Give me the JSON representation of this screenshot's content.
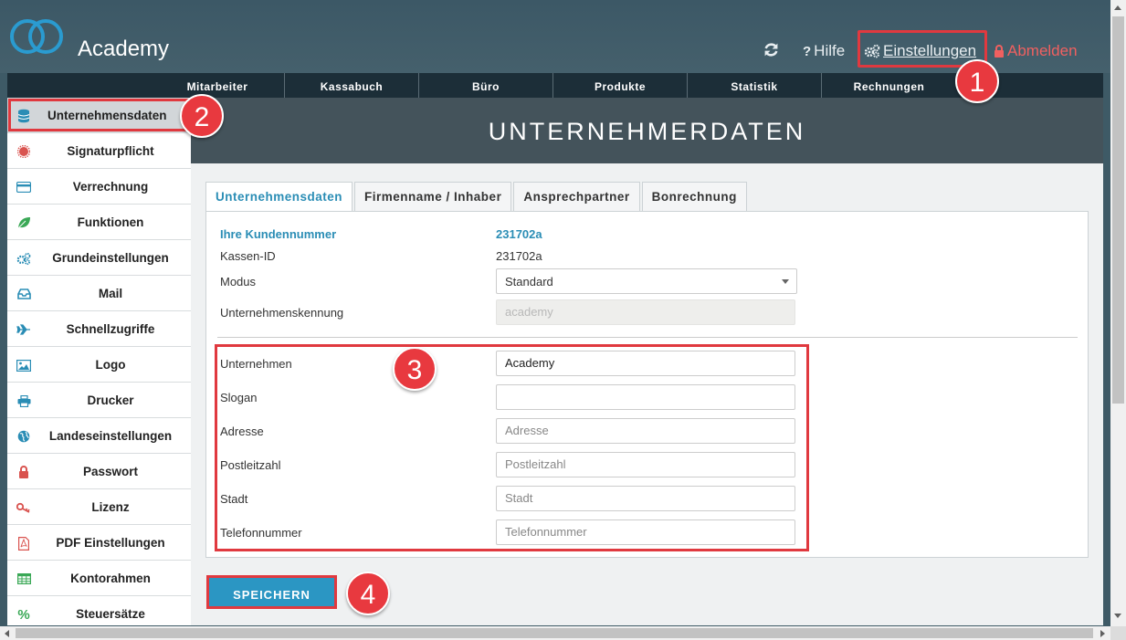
{
  "app": {
    "title": "Academy"
  },
  "header": {
    "help_label": "Hilfe",
    "settings_label": "Einstellungen",
    "logout_label": "Abmelden"
  },
  "nav": {
    "items": [
      "Mitarbeiter",
      "Kassabuch",
      "Büro",
      "Produkte",
      "Statistik",
      "Rechnungen"
    ]
  },
  "sidebar": {
    "items": [
      {
        "label": "Unternehmensdaten",
        "icon": "database-icon",
        "color": "#2a8db5"
      },
      {
        "label": "Signaturpflicht",
        "icon": "seal-icon",
        "color": "#d9534f"
      },
      {
        "label": "Verrechnung",
        "icon": "credit-card-icon",
        "color": "#2a8db5"
      },
      {
        "label": "Funktionen",
        "icon": "leaf-icon",
        "color": "#3aa856"
      },
      {
        "label": "Grundeinstellungen",
        "icon": "gears-icon",
        "color": "#2a8db5"
      },
      {
        "label": "Mail",
        "icon": "inbox-icon",
        "color": "#2a8db5"
      },
      {
        "label": "Schnellzugriffe",
        "icon": "plane-icon",
        "color": "#2a8db5"
      },
      {
        "label": "Logo",
        "icon": "image-icon",
        "color": "#2a8db5"
      },
      {
        "label": "Drucker",
        "icon": "printer-icon",
        "color": "#2a8db5"
      },
      {
        "label": "Landeseinstellungen",
        "icon": "globe-icon",
        "color": "#2a8db5"
      },
      {
        "label": "Passwort",
        "icon": "lock-icon",
        "color": "#d9534f"
      },
      {
        "label": "Lizenz",
        "icon": "key-icon",
        "color": "#d9534f"
      },
      {
        "label": "PDF Einstellungen",
        "icon": "pdf-icon",
        "color": "#d9534f"
      },
      {
        "label": "Kontorahmen",
        "icon": "table-icon",
        "color": "#3aa856"
      },
      {
        "label": "Steuersätze",
        "icon": "percent-icon",
        "color": "#3aa856"
      }
    ]
  },
  "page": {
    "title": "UNTERNEHMERDATEN",
    "tabs": [
      "Unternehmensdaten",
      "Firmenname / Inhaber",
      "Ansprechpartner",
      "Bonrechnung"
    ]
  },
  "form": {
    "kundennummer_label": "Ihre Kundennummer",
    "kundennummer_value": "231702a",
    "kassen_id_label": "Kassen-ID",
    "kassen_id_value": "231702a",
    "modus_label": "Modus",
    "modus_value": "Standard",
    "kennung_label": "Unternehmenskennung",
    "kennung_value": "academy",
    "unternehmen_label": "Unternehmen",
    "unternehmen_value": "Academy",
    "slogan_label": "Slogan",
    "slogan_value": "",
    "adresse_label": "Adresse",
    "adresse_placeholder": "Adresse",
    "plz_label": "Postleitzahl",
    "plz_placeholder": "Postleitzahl",
    "stadt_label": "Stadt",
    "stadt_placeholder": "Stadt",
    "telefon_label": "Telefonnummer",
    "telefon_placeholder": "Telefonnummer",
    "save_label": "SPEICHERN"
  },
  "markers": [
    "1",
    "2",
    "3",
    "4"
  ],
  "colors": {
    "accent": "#2a8db5",
    "highlight": "#e0393f",
    "banner": "#44535b",
    "navbar": "#1c2e38"
  }
}
